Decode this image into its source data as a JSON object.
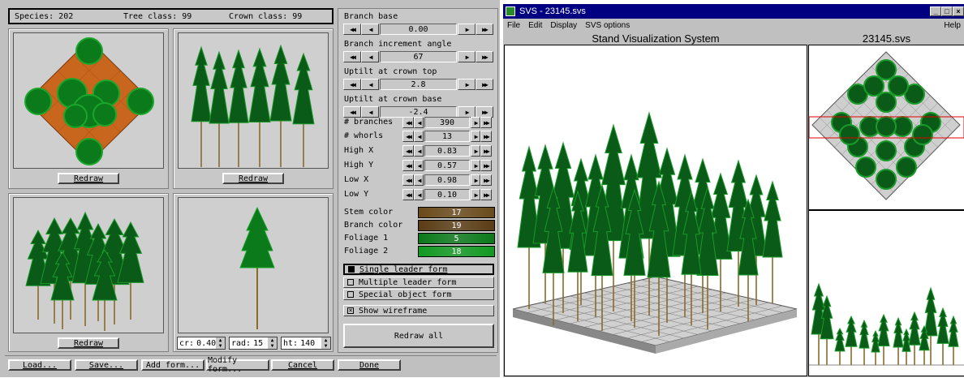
{
  "editor": {
    "species_label": "Species: 202",
    "tree_class_label": "Tree class: 99",
    "crown_class_label": "Crown class: 99",
    "redraw_label": "Redraw",
    "params": [
      {
        "name": "Branch base",
        "value": "0.00"
      },
      {
        "name": "Branch increment angle",
        "value": "67"
      },
      {
        "name": "Uptilt at crown top",
        "value": "2.8"
      },
      {
        "name": "Uptilt at crown base",
        "value": "-2.4"
      }
    ],
    "counts": [
      {
        "name": "# branches",
        "value": "390"
      },
      {
        "name": "# whorls",
        "value": "13"
      },
      {
        "name": "High X",
        "value": "0.83"
      },
      {
        "name": "High Y",
        "value": "0.57"
      },
      {
        "name": "Low X",
        "value": "0.98"
      },
      {
        "name": "Low Y",
        "value": "0.10"
      }
    ],
    "colors": [
      {
        "name": "Stem color",
        "value": "17",
        "bg": "#6a4a1a"
      },
      {
        "name": "Branch color",
        "value": "19",
        "bg": "#5a3c14"
      },
      {
        "name": "Foliage 1",
        "value": "5",
        "bg": "#0a7a1a"
      },
      {
        "name": "Foliage 2",
        "value": "18",
        "bg": "#109a20"
      }
    ],
    "forms": {
      "single": "Single leader form",
      "multiple": "Multiple leader form",
      "special": "Special object form"
    },
    "show_wireframe": "Show wireframe",
    "redraw_all": "Redraw all",
    "spinners": {
      "cr_label": "cr:",
      "cr_value": "0.40",
      "rad_label": "rad:",
      "rad_value": "15",
      "ht_label": "ht:",
      "ht_value": "140"
    },
    "bottom_buttons": {
      "load": "Load...",
      "save": "Save...",
      "add": "Add form...",
      "modify": "Modify form...",
      "cancel": "Cancel",
      "done": "Done"
    }
  },
  "svs": {
    "window_title": "SVS - 23145.svs",
    "menu": {
      "file": "File",
      "edit": "Edit",
      "display": "Display",
      "svs_options": "SVS options",
      "help": "Help"
    },
    "header_title": "Stand Visualization System",
    "header_file": "23145.svs"
  },
  "colors": {
    "foliage_dark": "#0a5a18",
    "foliage_light": "#1a9a2a",
    "stem": "#8a6a2a",
    "plot_orange": "#c8661e",
    "title_blue": "#000080"
  }
}
